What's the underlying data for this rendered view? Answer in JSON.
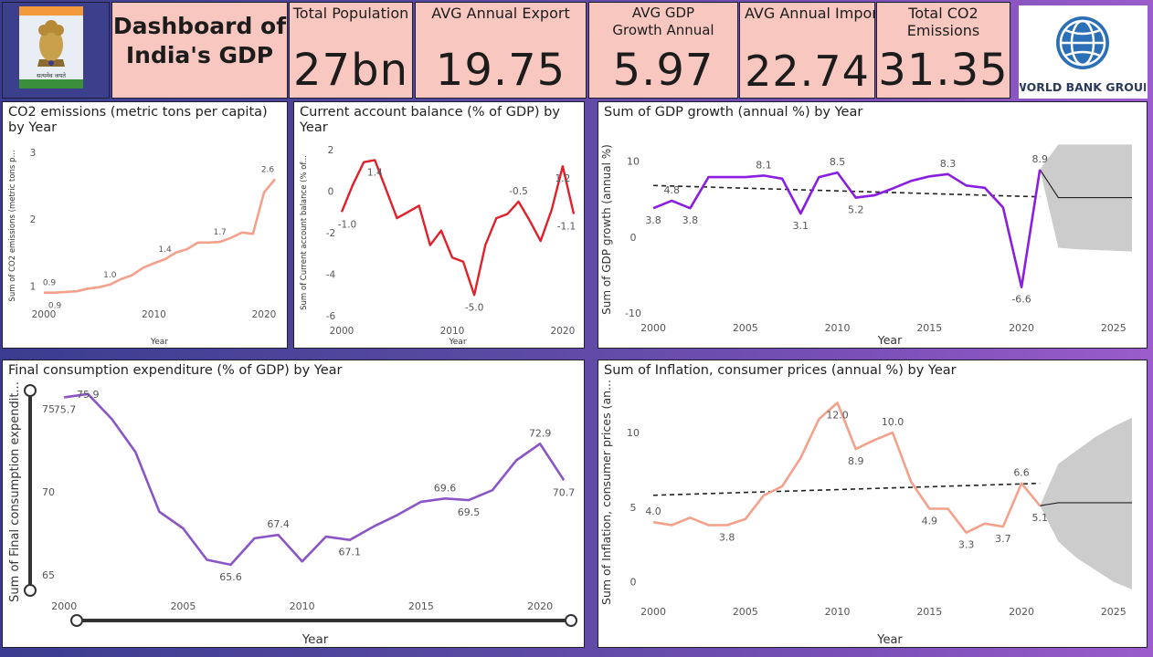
{
  "dashboard": {
    "title": "Dashboard of India's GDP",
    "emblem_text": "सत्यमेव जयते",
    "worldbank_text": "WORLD BANK GROUP"
  },
  "kpis": [
    {
      "label": "Total Population",
      "value": "27bn"
    },
    {
      "label": "AVG Annual Export",
      "value": "19.75"
    },
    {
      "label": "AVG GDP Growth Annual",
      "value": "5.97"
    },
    {
      "label": "AVG Annual Impor",
      "value": "22.74"
    },
    {
      "label": "Total CO2 Emissions",
      "value": "31.35"
    }
  ],
  "colors": {
    "co2": "#f4a18c",
    "cab": "#e0202a",
    "gdp": "#8b1de0",
    "fce": "#8a55c4",
    "inf": "#f4a18c",
    "forecast": "#cccccc"
  },
  "chart_data": [
    {
      "type": "line",
      "title": "CO2 emissions (metric tons per capita) by Year",
      "xlabel": "Year",
      "ylabel": "Sum of CO2 emissions (metric tons p...",
      "xlim": [
        2000,
        2021
      ],
      "ylim": [
        0.8,
        3
      ],
      "xticks": [
        "2000",
        "2010",
        "2020"
      ],
      "yticks": [
        "1",
        "2",
        "3"
      ],
      "x": [
        2000,
        2001,
        2002,
        2003,
        2004,
        2005,
        2006,
        2007,
        2008,
        2009,
        2010,
        2011,
        2012,
        2013,
        2014,
        2015,
        2016,
        2017,
        2018,
        2019,
        2020,
        2021
      ],
      "values": [
        0.9,
        0.9,
        0.91,
        0.92,
        0.96,
        0.98,
        1.02,
        1.1,
        1.16,
        1.27,
        1.34,
        1.4,
        1.5,
        1.55,
        1.65,
        1.65,
        1.66,
        1.72,
        1.8,
        1.78,
        2.4,
        2.6
      ],
      "data_labels": [
        {
          "x": 2000,
          "text": "0.9",
          "pos": "above"
        },
        {
          "x": 2001,
          "text": "0.9",
          "pos": "below"
        },
        {
          "x": 2006,
          "text": "1.0",
          "pos": "above"
        },
        {
          "x": 2011,
          "text": "1.4",
          "pos": "above"
        },
        {
          "x": 2016,
          "text": "1.7",
          "pos": "above"
        },
        {
          "x": 2021,
          "text": "2.6",
          "pos": "above"
        }
      ]
    },
    {
      "type": "line",
      "title": "Current account balance (% of GDP) by Year",
      "xlabel": "Year",
      "ylabel": "Sum of Current account balance (% of...",
      "xlim": [
        2000,
        2021
      ],
      "ylim": [
        -6,
        2
      ],
      "xticks": [
        "2000",
        "2010",
        "2020"
      ],
      "yticks": [
        "2",
        "0",
        "-2",
        "-4",
        "-6"
      ],
      "x": [
        2000,
        2001,
        2002,
        2003,
        2004,
        2005,
        2006,
        2007,
        2008,
        2009,
        2010,
        2011,
        2012,
        2013,
        2014,
        2015,
        2016,
        2017,
        2018,
        2019,
        2020,
        2021
      ],
      "values": [
        -1.0,
        0.3,
        1.4,
        1.5,
        0.1,
        -1.3,
        -1.0,
        -0.7,
        -2.6,
        -1.9,
        -3.2,
        -3.4,
        -5.0,
        -2.6,
        -1.3,
        -1.1,
        -0.5,
        -1.4,
        -2.4,
        -0.9,
        1.2,
        -1.1
      ],
      "data_labels": [
        {
          "x": 2000,
          "text": "-1.0",
          "pos": "below"
        },
        {
          "x": 2003,
          "text": "1.4",
          "pos": "below"
        },
        {
          "x": 2012,
          "text": "-5.0",
          "pos": "below"
        },
        {
          "x": 2016,
          "text": "-0.5",
          "pos": "above"
        },
        {
          "x": 2020,
          "text": "1.2",
          "pos": "below"
        },
        {
          "x": 2021,
          "text": "-1.1",
          "pos": "below"
        }
      ]
    },
    {
      "type": "line",
      "title": "Sum of GDP growth (annual %) by Year",
      "xlabel": "Year",
      "ylabel": "Sum of GDP growth (annual %)",
      "xlim": [
        1999.5,
        2026.2
      ],
      "ylim": [
        -10,
        12
      ],
      "xticks": [
        "2000",
        "2005",
        "2010",
        "2015",
        "2020",
        "2025"
      ],
      "yticks": [
        "10",
        "0",
        "-10"
      ],
      "x": [
        2000,
        2001,
        2002,
        2003,
        2004,
        2005,
        2006,
        2007,
        2008,
        2009,
        2010,
        2011,
        2012,
        2013,
        2014,
        2015,
        2016,
        2017,
        2018,
        2019,
        2020,
        2021
      ],
      "values": [
        3.8,
        4.8,
        3.8,
        7.9,
        7.9,
        7.9,
        8.1,
        7.7,
        3.1,
        7.9,
        8.5,
        5.2,
        5.5,
        6.4,
        7.4,
        8.0,
        8.3,
        6.8,
        6.5,
        3.9,
        -6.6,
        8.9
      ],
      "trend": [
        [
          2000,
          6.8
        ],
        [
          2021,
          5.3
        ]
      ],
      "forecast": {
        "x": [
          2021,
          2022,
          2023,
          2024,
          2025,
          2026
        ],
        "value": [
          8.9,
          5.2,
          5.2,
          5.2,
          5.2,
          5.2
        ],
        "upper": [
          8.9,
          12.2,
          12.2,
          12.2,
          12.2,
          12.2
        ],
        "lower": [
          8.9,
          -1.4,
          -1.6,
          -1.7,
          -1.8,
          -1.9
        ]
      },
      "data_labels": [
        {
          "x": 2000,
          "text": "3.8",
          "pos": "below"
        },
        {
          "x": 2001,
          "text": "4.8",
          "pos": "above"
        },
        {
          "x": 2002,
          "text": "3.8",
          "pos": "below"
        },
        {
          "x": 2006,
          "text": "8.1",
          "pos": "above"
        },
        {
          "x": 2008,
          "text": "3.1",
          "pos": "below"
        },
        {
          "x": 2010,
          "text": "8.5",
          "pos": "above"
        },
        {
          "x": 2011,
          "text": "5.2",
          "pos": "below"
        },
        {
          "x": 2016,
          "text": "8.3",
          "pos": "above"
        },
        {
          "x": 2020,
          "text": "-6.6",
          "pos": "below"
        },
        {
          "x": 2021,
          "text": "8.9",
          "pos": "above"
        }
      ]
    },
    {
      "type": "line",
      "title": "Final consumption expenditure (% of GDP) by Year",
      "xlabel": "Year",
      "ylabel": "Sum of Final consumption expendit...",
      "xlim": [
        1999.8,
        2021.3
      ],
      "ylim": [
        64,
        76
      ],
      "xticks": [
        "2000",
        "2005",
        "2010",
        "2015",
        "2020"
      ],
      "yticks": [
        "75",
        "70",
        "65"
      ],
      "x": [
        2000,
        2001,
        2002,
        2003,
        2004,
        2005,
        2006,
        2007,
        2008,
        2009,
        2010,
        2011,
        2012,
        2013,
        2014,
        2015,
        2016,
        2017,
        2018,
        2019,
        2020,
        2021
      ],
      "values": [
        75.7,
        75.9,
        74.4,
        72.4,
        68.8,
        67.8,
        65.9,
        65.6,
        67.2,
        67.4,
        65.8,
        67.3,
        67.1,
        67.9,
        68.6,
        69.4,
        69.6,
        69.5,
        70.1,
        71.9,
        72.9,
        70.7
      ],
      "data_labels": [
        {
          "x": 2000,
          "text": "75.7",
          "pos": "below"
        },
        {
          "x": 2001,
          "text": "75.9",
          "pos": "on"
        },
        {
          "x": 2007,
          "text": "65.6",
          "pos": "below"
        },
        {
          "x": 2009,
          "text": "67.4",
          "pos": "above"
        },
        {
          "x": 2012,
          "text": "67.1",
          "pos": "below"
        },
        {
          "x": 2016,
          "text": "69.6",
          "pos": "above"
        },
        {
          "x": 2017,
          "text": "69.5",
          "pos": "below"
        },
        {
          "x": 2020,
          "text": "72.9",
          "pos": "above"
        },
        {
          "x": 2021,
          "text": "70.7",
          "pos": "below"
        }
      ]
    },
    {
      "type": "line",
      "title": "Sum of Inflation, consumer prices (annual %) by Year",
      "xlabel": "Year",
      "ylabel": "Sum of Inflation, consumer prices (an...",
      "xlim": [
        1999.5,
        2026.2
      ],
      "ylim": [
        -1,
        13
      ],
      "xticks": [
        "2000",
        "2005",
        "2010",
        "2015",
        "2020",
        "2025"
      ],
      "yticks": [
        "10",
        "5",
        "0"
      ],
      "x": [
        2000,
        2001,
        2002,
        2003,
        2004,
        2005,
        2006,
        2007,
        2008,
        2009,
        2010,
        2011,
        2012,
        2013,
        2014,
        2015,
        2016,
        2017,
        2018,
        2019,
        2020,
        2021
      ],
      "values": [
        4.0,
        3.8,
        4.3,
        3.8,
        3.8,
        4.2,
        5.8,
        6.4,
        8.3,
        10.9,
        12.0,
        8.9,
        9.5,
        10.0,
        6.7,
        4.9,
        4.9,
        3.3,
        3.9,
        3.7,
        6.6,
        5.1
      ],
      "trend": [
        [
          2000,
          5.8
        ],
        [
          2021,
          6.6
        ]
      ],
      "forecast": {
        "x": [
          2021,
          2022,
          2023,
          2024,
          2025,
          2026
        ],
        "value": [
          5.1,
          5.3,
          5.3,
          5.3,
          5.3,
          5.3
        ],
        "upper": [
          5.1,
          7.9,
          8.8,
          9.7,
          10.4,
          11.0
        ],
        "lower": [
          5.1,
          2.7,
          1.6,
          0.8,
          0.0,
          -0.5
        ]
      },
      "data_labels": [
        {
          "x": 2000,
          "text": "4.0",
          "pos": "above"
        },
        {
          "x": 2004,
          "text": "3.8",
          "pos": "below"
        },
        {
          "x": 2010,
          "text": "12.0",
          "pos": "below"
        },
        {
          "x": 2011,
          "text": "8.9",
          "pos": "below"
        },
        {
          "x": 2013,
          "text": "10.0",
          "pos": "above"
        },
        {
          "x": 2015,
          "text": "4.9",
          "pos": "below"
        },
        {
          "x": 2017,
          "text": "3.3",
          "pos": "below"
        },
        {
          "x": 2019,
          "text": "3.7",
          "pos": "below"
        },
        {
          "x": 2020,
          "text": "6.6",
          "pos": "above"
        },
        {
          "x": 2021,
          "text": "5.1",
          "pos": "below"
        }
      ]
    }
  ]
}
